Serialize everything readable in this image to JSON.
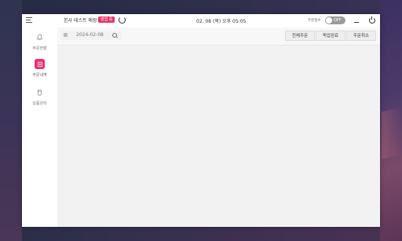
{
  "topbar": {
    "store_name": "본사 테스트 매장",
    "status_badge": "영업 중",
    "datetime": "02. 08 (목) 오후 05:05",
    "receive_label": "주문접수",
    "toggle_text": "OFF"
  },
  "sidebar": {
    "items": [
      {
        "label": "주문현황",
        "icon": "bell-icon"
      },
      {
        "label": "주문내역",
        "icon": "receipt-icon",
        "active": true
      },
      {
        "label": "상품관리",
        "icon": "cup-icon"
      }
    ]
  },
  "filter": {
    "date": "2024-02-08",
    "buttons": [
      "전체주문",
      "픽업완료",
      "주문취소"
    ]
  },
  "colors": {
    "accent": "#e8336b",
    "toggle_off": "#9a9a9a",
    "content_bg": "#f2f2f2"
  }
}
